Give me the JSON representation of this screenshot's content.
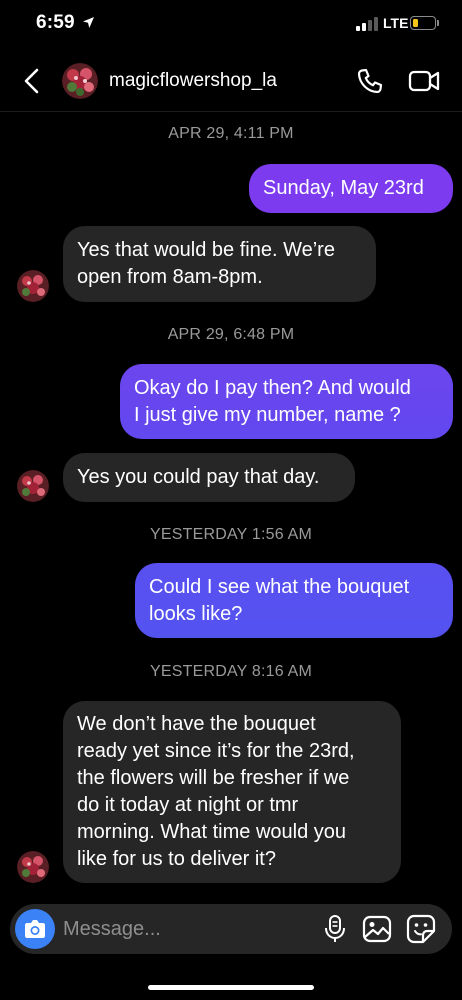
{
  "status_bar": {
    "time": "6:59",
    "network": "LTE",
    "battery_level": 0.25,
    "battery_color": "#f5c518"
  },
  "header": {
    "contact_name": "magicflowershop_la",
    "back_icon": "chevron-left-icon",
    "call_icon": "phone-icon",
    "video_icon": "video-camera-icon"
  },
  "colors": {
    "incoming_bubble": "#262626",
    "outgoing_top": "#7b3cf0",
    "outgoing_bottom": "#5b4ff0",
    "timestamp": "#9a9a9a",
    "camera_button": "#3b82f6"
  },
  "timestamps": [
    "APR 29, 4:11 PM",
    "APR 29, 6:48 PM",
    "YESTERDAY 1:56 AM",
    "YESTERDAY 8:16 AM"
  ],
  "messages": [
    {
      "direction": "out",
      "lines": [
        "Sunday, May 23rd"
      ]
    },
    {
      "direction": "in",
      "lines": [
        "Yes that would be fine. We’re",
        "open from 8am-8pm."
      ]
    },
    {
      "direction": "out",
      "lines": [
        "Okay do I pay then? And would",
        "I just give my number,  name ?"
      ]
    },
    {
      "direction": "in",
      "lines": [
        "Yes you could pay that day."
      ]
    },
    {
      "direction": "out",
      "lines": [
        "Could I see what the bouquet",
        "looks like?"
      ]
    },
    {
      "direction": "in",
      "lines": [
        "We don’t have the bouquet",
        "ready yet since it’s for the 23rd,",
        "the flowers will be fresher if we",
        "do it today at night or tmr",
        "morning. What time would you",
        "like for us to deliver it?"
      ]
    }
  ],
  "composer": {
    "placeholder": "Message...",
    "camera_icon": "camera-icon",
    "mic_icon": "microphone-icon",
    "gallery_icon": "image-gallery-icon",
    "sticker_icon": "sticker-icon"
  }
}
